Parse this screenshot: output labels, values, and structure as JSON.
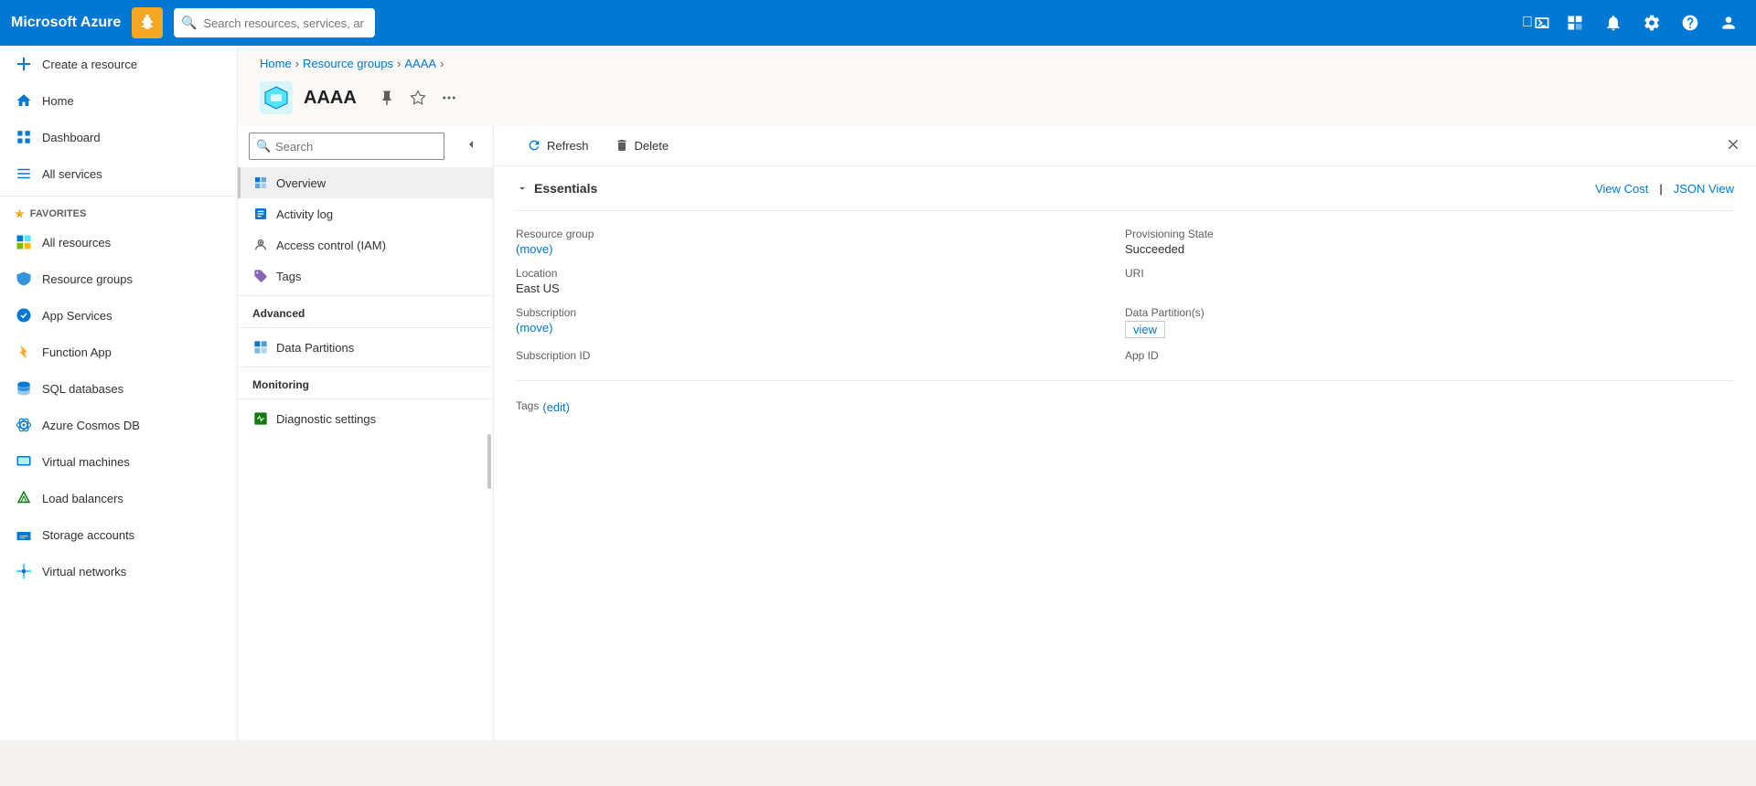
{
  "topnav": {
    "brand": "Microsoft Azure",
    "search_placeholder": "Search resources, services, and docs (G+/)",
    "icon_label": "bug-icon"
  },
  "sidebar": {
    "create_resource": "Create a resource",
    "home": "Home",
    "dashboard": "Dashboard",
    "all_services": "All services",
    "favorites_label": "FAVORITES",
    "items": [
      {
        "id": "all-resources",
        "label": "All resources"
      },
      {
        "id": "resource-groups",
        "label": "Resource groups"
      },
      {
        "id": "app-services",
        "label": "App Services"
      },
      {
        "id": "function-app",
        "label": "Function App"
      },
      {
        "id": "sql-databases",
        "label": "SQL databases"
      },
      {
        "id": "azure-cosmos-db",
        "label": "Azure Cosmos DB"
      },
      {
        "id": "virtual-machines",
        "label": "Virtual machines"
      },
      {
        "id": "load-balancers",
        "label": "Load balancers"
      },
      {
        "id": "storage-accounts",
        "label": "Storage accounts"
      },
      {
        "id": "virtual-networks",
        "label": "Virtual networks"
      }
    ]
  },
  "breadcrumb": {
    "home": "Home",
    "resource_groups": "Resource groups",
    "current": "AAAA"
  },
  "resource": {
    "name": "AAAA",
    "subtitle": ""
  },
  "toolbar": {
    "refresh_label": "Refresh",
    "delete_label": "Delete"
  },
  "left_panel": {
    "search_placeholder": "Search",
    "nav_items": [
      {
        "id": "overview",
        "label": "Overview",
        "active": true
      },
      {
        "id": "activity-log",
        "label": "Activity log"
      },
      {
        "id": "access-control",
        "label": "Access control (IAM)"
      },
      {
        "id": "tags",
        "label": "Tags"
      }
    ],
    "sections": [
      {
        "label": "Advanced",
        "items": [
          {
            "id": "data-partitions",
            "label": "Data Partitions"
          }
        ]
      },
      {
        "label": "Monitoring",
        "items": [
          {
            "id": "diagnostic-settings",
            "label": "Diagnostic settings"
          }
        ]
      }
    ]
  },
  "essentials": {
    "title": "Essentials",
    "view_cost": "View Cost",
    "json_view": "JSON View",
    "fields": [
      {
        "label": "Resource group",
        "value": "",
        "link_text": "move",
        "has_link": true
      },
      {
        "label": "Provisioning State",
        "value": "Succeeded",
        "has_link": false
      },
      {
        "label": "Location",
        "value": "East US",
        "has_link": false
      },
      {
        "label": "URI",
        "value": "URI",
        "has_link": false
      },
      {
        "label": "Subscription",
        "value": "",
        "link_text": "move",
        "has_link": true
      },
      {
        "label": "Data Partition(s)",
        "value": "view",
        "has_outlined_link": true
      },
      {
        "label": "Subscription ID",
        "value": "Subscription ID",
        "has_link": false
      },
      {
        "label": "App ID",
        "value": "App ID",
        "has_link": false
      }
    ],
    "tags_label": "Tags",
    "tags_edit": "edit"
  }
}
